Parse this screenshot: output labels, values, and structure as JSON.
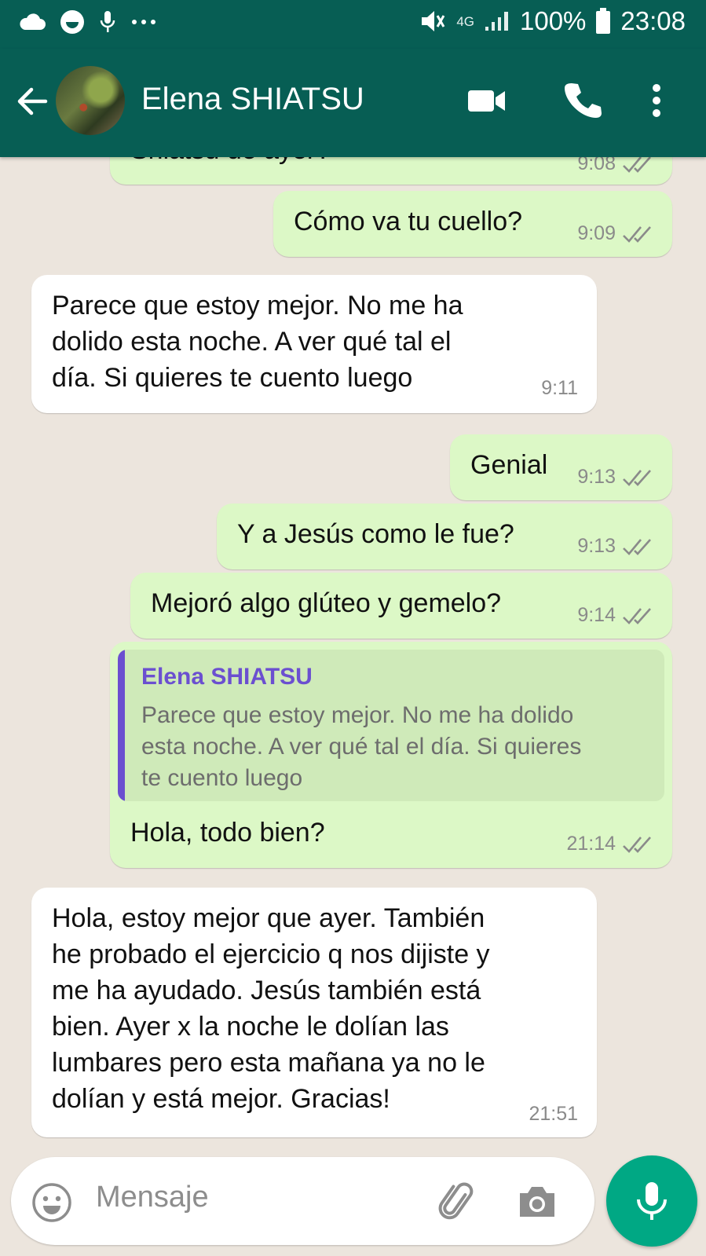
{
  "status_bar": {
    "battery": "100%",
    "time": "23:08",
    "network": "4G",
    "left_icons": [
      "cloud-icon",
      "smiley-notification-icon",
      "mic-notification-icon",
      "more-dots-icon"
    ]
  },
  "header": {
    "contact_name": "Elena SHIATSU",
    "icons": [
      "back-arrow-icon",
      "video-call-icon",
      "phone-icon",
      "more-vert-icon"
    ]
  },
  "messages": [
    {
      "direction": "out",
      "text": "Shiatsu de ayer?",
      "time": "9:08",
      "status": "read"
    },
    {
      "direction": "out",
      "text": "Cómo va tu cuello?",
      "time": "9:09",
      "status": "read"
    },
    {
      "direction": "in",
      "lines": [
        "Parece que estoy mejor. No me ha",
        "dolido esta noche. A ver qué tal el",
        "día. Si quieres te cuento luego"
      ],
      "time": "9:11"
    },
    {
      "direction": "out",
      "text": "Genial",
      "time": "9:13",
      "status": "read"
    },
    {
      "direction": "out",
      "text": "Y a Jesús como le fue?",
      "time": "9:13",
      "status": "read"
    },
    {
      "direction": "out",
      "text": "Mejoró algo glúteo y gemelo?",
      "time": "9:14",
      "status": "read"
    },
    {
      "direction": "out",
      "quote": {
        "name": "Elena SHIATSU",
        "lines": [
          "Parece que estoy mejor. No me ha dolido",
          "esta noche. A ver qué tal el día. Si quieres",
          "te cuento luego"
        ]
      },
      "text": "Hola, todo bien?",
      "time": "21:14",
      "status": "read"
    },
    {
      "direction": "in",
      "lines": [
        "Hola, estoy mejor que ayer. También",
        "he probado el ejercicio q nos dijiste y",
        "me ha ayudado. Jesús también está",
        "bien. Ayer x la noche le dolían las",
        "lumbares pero esta mañana ya no le",
        "dolían y está mejor. Gracias!"
      ],
      "time": "21:51"
    }
  ],
  "composer": {
    "placeholder": "Mensaje",
    "icons": [
      "emoji-icon",
      "attach-icon",
      "camera-icon",
      "mic-icon"
    ]
  },
  "colors": {
    "header": "#075e54",
    "outgoing_bubble": "#dcf8c6",
    "incoming_bubble": "#ffffff",
    "background": "#ece5dd",
    "read_ticks": "#8a8a8a",
    "quote_accent": "#6b4fd0",
    "mic_button": "#00a884"
  }
}
